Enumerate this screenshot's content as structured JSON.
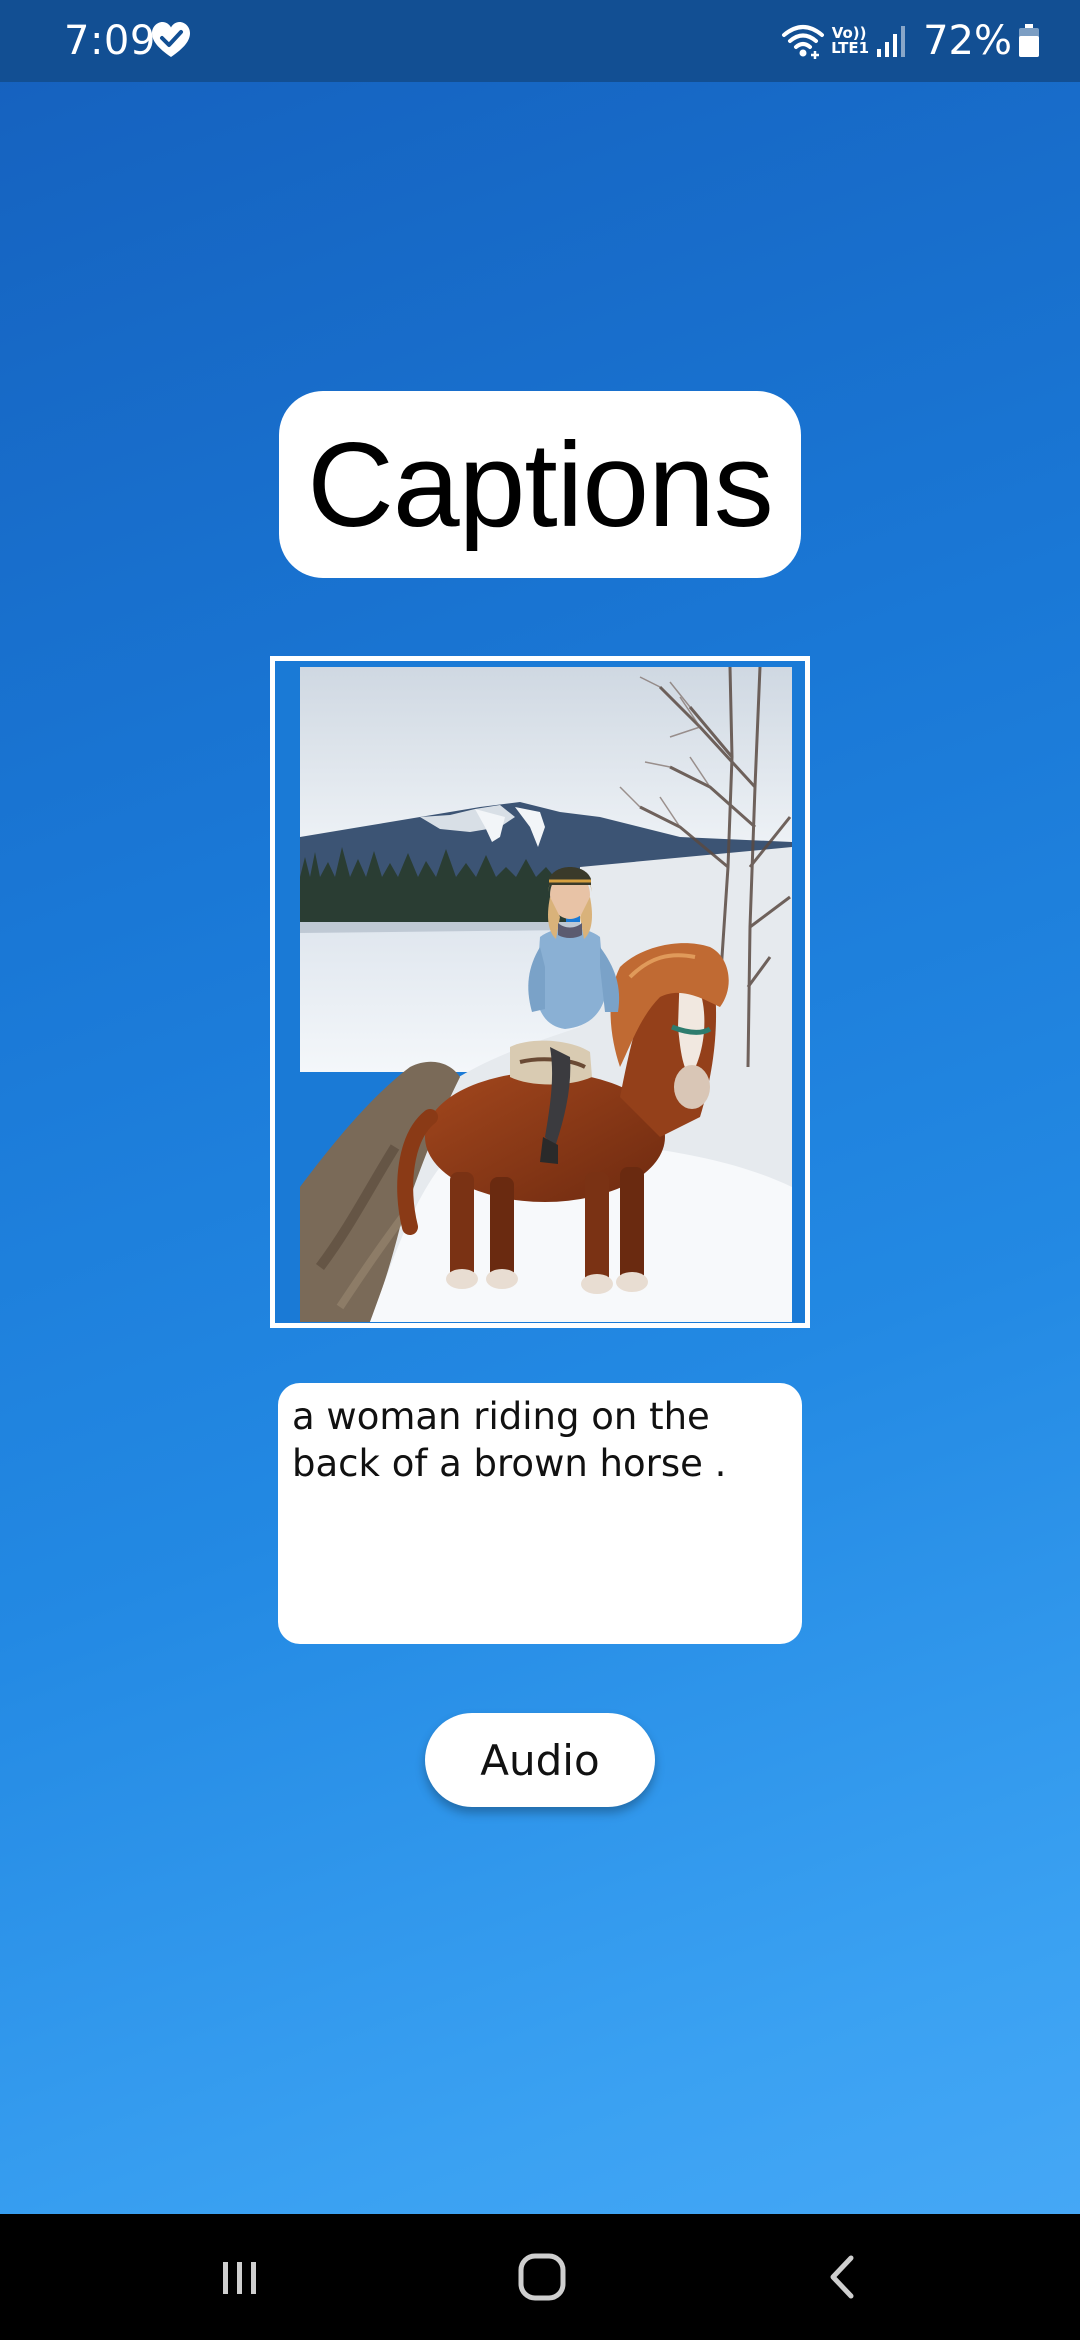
{
  "status_bar": {
    "time": "7:09",
    "battery_percent": "72%",
    "network_label": "Vo)) LTE1",
    "icons": [
      "health-heart-check-icon",
      "wifi-icon",
      "volte-icon",
      "signal-icon",
      "battery-icon"
    ]
  },
  "title": "Captions",
  "photo": {
    "description_icon": "photo-woman-on-horse"
  },
  "caption": {
    "text": "a woman riding on the back of a brown horse ."
  },
  "audio_button": {
    "label": "Audio"
  },
  "nav_bar": {
    "icons": [
      "recent-apps-icon",
      "home-icon",
      "back-icon"
    ]
  },
  "colors": {
    "status_bar_bg": "#124f93",
    "background_top": "#1560bd",
    "background_bottom": "#4aaaf7",
    "card_bg": "#ffffff",
    "nav_bar_bg": "#000000"
  }
}
